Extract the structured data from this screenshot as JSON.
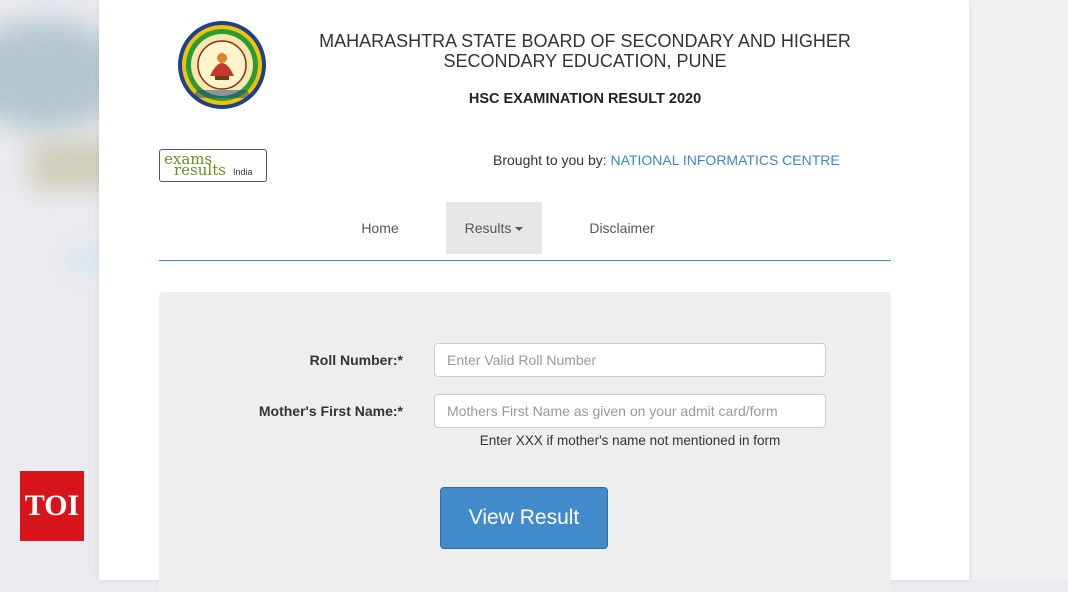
{
  "header": {
    "board_name": "MAHARASHTRA STATE BOARD OF SECONDARY AND HIGHER SECONDARY EDUCATION, PUNE",
    "exam_title": "HSC EXAMINATION RESULT 2020"
  },
  "partner": {
    "badge_line1": "exams",
    "badge_line2": "results",
    "badge_line3": "India",
    "brought_prefix": "Brought to you by:",
    "provider": "NATIONAL INFORMATICS CENTRE"
  },
  "nav": {
    "home": "Home",
    "results": "Results",
    "disclaimer": "Disclaimer"
  },
  "form": {
    "roll_label": "Roll Number:*",
    "roll_placeholder": "Enter Valid Roll Number",
    "roll_value": "",
    "mother_label": "Mother's First Name:*",
    "mother_placeholder": "Mothers First Name as given on your admit card/form",
    "mother_value": "",
    "mother_hint": "Enter XXX if mother's name not mentioned in form",
    "submit_label": "View Result"
  },
  "watermark": {
    "brand": "TOI"
  },
  "colors": {
    "accent_blue": "#428bca",
    "link_blue": "#3e86c6",
    "toi_red": "#d7141a"
  }
}
